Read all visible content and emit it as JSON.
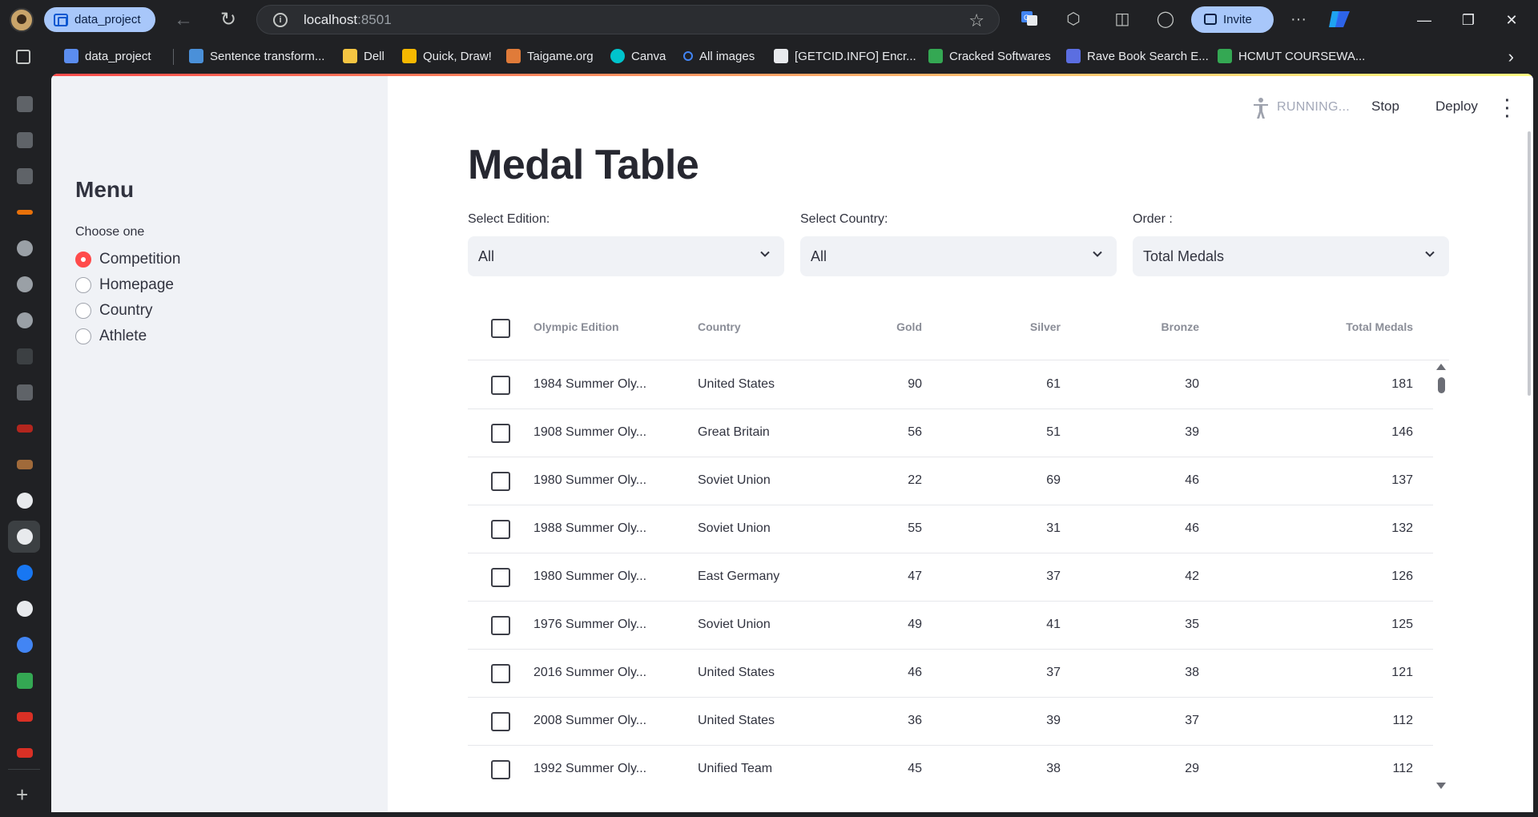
{
  "browser": {
    "workspace_label": "data_project",
    "url_host": "localhost",
    "url_port": ":8501",
    "invite_label": "Invite",
    "bookmarks": [
      {
        "label": "data_project",
        "color": "#5b8def"
      },
      {
        "label": "Sentence transform...",
        "color": "#4a90d9"
      },
      {
        "label": "Dell",
        "color": "#f4c542"
      },
      {
        "label": "Quick, Draw!",
        "color": "#f5b800"
      },
      {
        "label": "Taigame.org",
        "color": "#e07b39"
      },
      {
        "label": "Canva",
        "color": "#00c4cc"
      },
      {
        "label": "All images",
        "color": "#4285f4"
      },
      {
        "label": "[GETCID.INFO] Encr...",
        "color": "#e8eaed"
      },
      {
        "label": "Cracked Softwares",
        "color": "#34a853"
      },
      {
        "label": "Rave Book Search E...",
        "color": "#5b6ee1"
      },
      {
        "label": "HCMUT COURSEWA...",
        "color": "#34a853"
      }
    ]
  },
  "app": {
    "toolbar": {
      "running_label": "RUNNING...",
      "stop_label": "Stop",
      "deploy_label": "Deploy"
    },
    "sidebar": {
      "title": "Menu",
      "radio_label": "Choose one",
      "options": [
        "Competition",
        "Homepage",
        "Country",
        "Athlete"
      ],
      "selected": "Competition"
    },
    "title": "Medal Table",
    "filters": [
      {
        "label": "Select Edition:",
        "value": "All"
      },
      {
        "label": "Select Country:",
        "value": "All"
      },
      {
        "label": "Order :",
        "value": "Total Medals"
      }
    ],
    "table": {
      "columns": [
        "Olympic Edition",
        "Country",
        "Gold",
        "Silver",
        "Bronze",
        "Total Medals"
      ],
      "rows": [
        [
          "1984 Summer Oly...",
          "United States",
          "90",
          "61",
          "30",
          "181"
        ],
        [
          "1908 Summer Oly...",
          "Great Britain",
          "56",
          "51",
          "39",
          "146"
        ],
        [
          "1980 Summer Oly...",
          "Soviet Union",
          "22",
          "69",
          "46",
          "137"
        ],
        [
          "1988 Summer Oly...",
          "Soviet Union",
          "55",
          "31",
          "46",
          "132"
        ],
        [
          "1980 Summer Oly...",
          "East Germany",
          "47",
          "37",
          "42",
          "126"
        ],
        [
          "1976 Summer Oly...",
          "Soviet Union",
          "49",
          "41",
          "35",
          "125"
        ],
        [
          "2016 Summer Oly...",
          "United States",
          "46",
          "37",
          "38",
          "121"
        ],
        [
          "2008 Summer Oly...",
          "United States",
          "36",
          "39",
          "37",
          "112"
        ],
        [
          "1992 Summer Oly...",
          "Unified Team",
          "45",
          "38",
          "29",
          "112"
        ]
      ]
    }
  },
  "colors": {
    "accent": "#ff4b4b",
    "sidebar_bg": "#f0f2f6",
    "text": "#31333f"
  }
}
